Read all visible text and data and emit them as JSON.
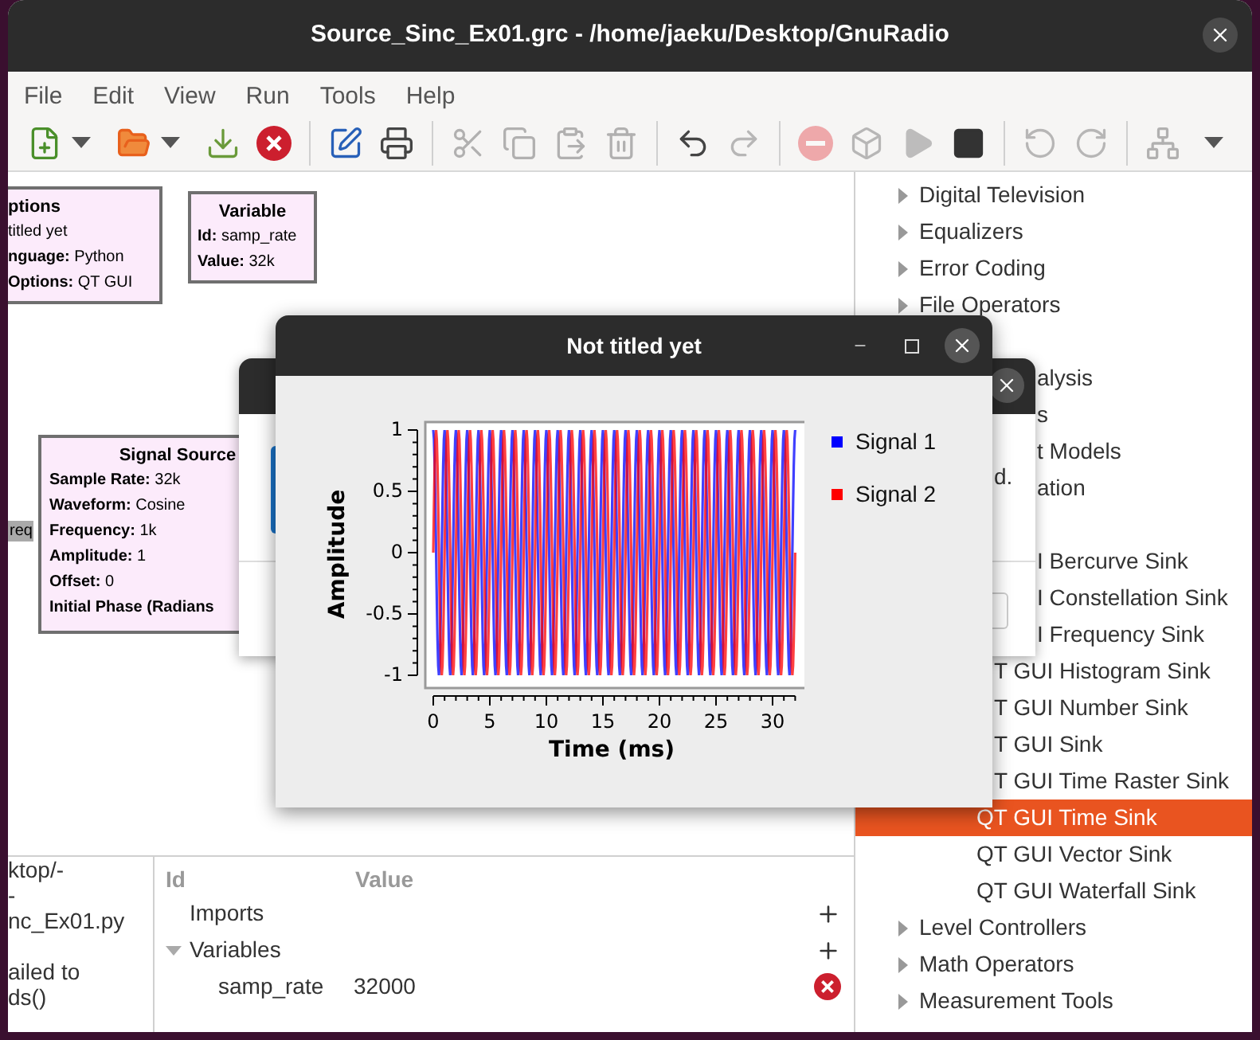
{
  "window": {
    "title": "Source_Sinc_Ex01.grc - /home/jaeku/Desktop/GnuRadio"
  },
  "menu": [
    "File",
    "Edit",
    "View",
    "Run",
    "Tools",
    "Help"
  ],
  "toolbar": [
    {
      "kind": "menu",
      "disabled": false
    },
    {
      "kind": "menu",
      "disabled": false
    },
    {
      "kind": "button",
      "disabled": false
    },
    {
      "kind": "button",
      "disabled": false
    },
    {
      "kind": "separator"
    },
    {
      "kind": "button",
      "disabled": false
    },
    {
      "kind": "button",
      "disabled": false
    },
    {
      "kind": "separator"
    },
    {
      "kind": "button",
      "disabled": true
    },
    {
      "kind": "button",
      "disabled": true
    },
    {
      "kind": "button",
      "disabled": true
    },
    {
      "kind": "button",
      "disabled": true
    },
    {
      "kind": "separator"
    },
    {
      "kind": "button",
      "disabled": false
    },
    {
      "kind": "button",
      "disabled": true
    },
    {
      "kind": "separator"
    },
    {
      "kind": "button",
      "disabled": true
    },
    {
      "kind": "button",
      "disabled": true
    },
    {
      "kind": "button",
      "disabled": true
    },
    {
      "kind": "button",
      "disabled": false
    },
    {
      "kind": "separator"
    },
    {
      "kind": "button",
      "disabled": true
    },
    {
      "kind": "button",
      "disabled": true
    },
    {
      "kind": "separator"
    },
    {
      "kind": "button",
      "disabled": true
    },
    {
      "kind": "overflow",
      "disabled": false
    }
  ],
  "canvas": {
    "blocks": [
      {
        "title": "ptions",
        "params": [
          {
            "value": "titled yet"
          },
          {
            "name": "nguage:",
            "value": "Python"
          },
          {
            "name": "Options:",
            "value": "QT GUI"
          }
        ]
      },
      {
        "title": "Variable",
        "params": [
          {
            "name": "Id:",
            "value": "samp_rate"
          },
          {
            "name": "Value:",
            "value": "32k"
          }
        ]
      },
      {
        "title": "Signal Source",
        "params": [
          {
            "name": "Sample Rate:",
            "value": "32k"
          },
          {
            "name": "Waveform:",
            "value": "Cosine"
          },
          {
            "name": "Frequency:",
            "value": "1k"
          },
          {
            "name": "Amplitude:",
            "value": "1"
          },
          {
            "name": "Offset:",
            "value": "0"
          },
          {
            "name": "Initial Phase (Radians"
          }
        ]
      }
    ],
    "port_label": "req"
  },
  "console": [
    [
      "ktop/-",
      "-",
      "nc_Ex01.py"
    ],
    [
      "ailed to",
      "ds()"
    ]
  ],
  "variables": {
    "columns": [
      "Id",
      "Value"
    ],
    "rows": [
      {
        "label": "Imports"
      },
      {
        "label": "Variables",
        "expanded": true,
        "children": [
          {
            "id": "samp_rate",
            "value": "32000"
          }
        ]
      }
    ]
  },
  "tree": [
    {
      "label": "Digital Television",
      "expanded": false
    },
    {
      "label": "Equalizers",
      "expanded": false
    },
    {
      "label": "Error Coding",
      "expanded": false
    },
    {
      "label": "File Operators",
      "expanded": false
    },
    {
      "label": "alysis"
    },
    {
      "label": "s"
    },
    {
      "label": "t Models"
    },
    {
      "label": "ation",
      "children": [
        {
          "label": "I Bercurve Sink",
          "selected": false
        },
        {
          "label": "I Constellation Sink",
          "selected": false
        },
        {
          "label": "I Frequency Sink",
          "selected": false
        },
        {
          "label": "T GUI Histogram Sink",
          "selected": false
        },
        {
          "label": "T GUI Number Sink",
          "selected": false
        },
        {
          "label": "T GUI Sink",
          "selected": false
        },
        {
          "label": "T GUI Time Raster Sink",
          "selected": false
        },
        {
          "label": "QT GUI Time Sink",
          "selected": true
        },
        {
          "label": "QT GUI Vector Sink",
          "selected": false
        },
        {
          "label": "QT GUI Waterfall Sink",
          "selected": false
        }
      ]
    },
    {
      "label": "Level Controllers",
      "expanded": false
    },
    {
      "label": "Math Operators",
      "expanded": false
    },
    {
      "label": "Measurement Tools",
      "expanded": false
    }
  ],
  "back_dialog": {
    "text": "d."
  },
  "plot_window": {
    "title": "Not titled yet",
    "plot": {
      "ylabel": "Amplitude",
      "xlabel": "Time (ms)",
      "yticks": [
        "1",
        "0.5",
        "0",
        "-0.5",
        "-1"
      ],
      "xticks": [
        "0",
        "5",
        "10",
        "15",
        "20",
        "25",
        "30"
      ]
    },
    "legend": [
      {
        "name": "Signal 1",
        "color": "#0000ff"
      },
      {
        "name": "Signal 2",
        "color": "#ff0000"
      }
    ]
  }
}
